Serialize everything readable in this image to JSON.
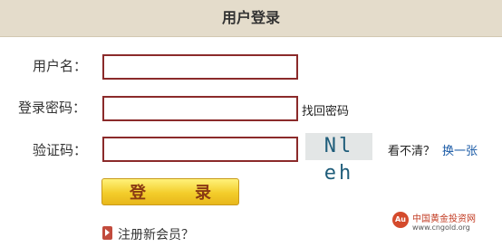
{
  "header": {
    "title": "用户登录"
  },
  "form": {
    "username_label": "用户名：",
    "password_label": "登录密码：",
    "captcha_label": "验证码：",
    "username_value": "",
    "password_value": "",
    "captcha_value": "",
    "forgot_password": "找回密码",
    "captcha_text": "Nl eh",
    "unclear_text": "看不清？",
    "refresh_captcha": "换一张",
    "login_button": "登　录",
    "register_link": "注册新会员？"
  },
  "watermark": {
    "logo_text": "Au",
    "site_name": "中国黄金投资网",
    "site_url": "www.cngold.org"
  },
  "colors": {
    "header_bg": "#e4dccb",
    "input_border": "#8b2a2a",
    "button_yellow": "#f3cd2b",
    "link_blue": "#1a5aa6"
  }
}
